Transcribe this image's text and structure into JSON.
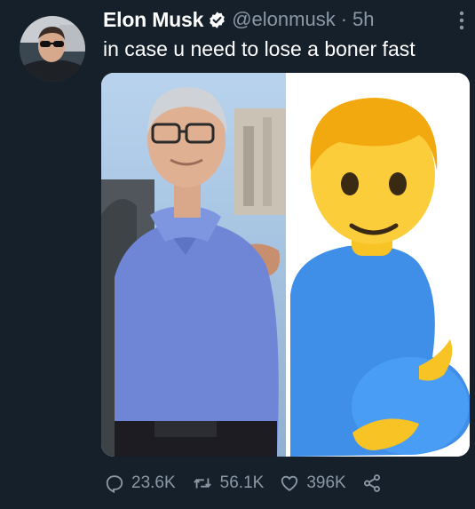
{
  "tweet": {
    "author_name": "Elon Musk",
    "handle": "@elonmusk",
    "separator": "·",
    "time": "5h",
    "text": "in case u need to lose a boner fast",
    "verified_icon": "verified-badge-icon",
    "more_icon": "more-vertical-icon"
  },
  "media": {
    "left_panel": "photo",
    "right_panel": "pregnant-man-emoji"
  },
  "actions": {
    "replies": "23.6K",
    "retweets": "56.1K",
    "likes": "396K",
    "reply_icon": "reply-icon",
    "retweet_icon": "retweet-icon",
    "like_icon": "heart-icon",
    "share_icon": "share-icon"
  },
  "colors": {
    "background": "#15202b",
    "text_primary": "#ffffff",
    "text_secondary": "#8b98a5",
    "verified": "#ffffff"
  }
}
